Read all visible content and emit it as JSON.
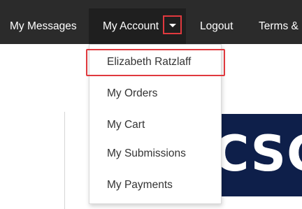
{
  "navbar": {
    "items": [
      {
        "label": "My Messages"
      },
      {
        "label": "My Account"
      },
      {
        "label": "Logout"
      },
      {
        "label": "Terms &"
      }
    ]
  },
  "account_menu": {
    "items": [
      {
        "label": "Elizabeth Ratzlaff"
      },
      {
        "label": "My Orders"
      },
      {
        "label": "My Cart"
      },
      {
        "label": "My Submissions"
      },
      {
        "label": "My Payments"
      }
    ]
  },
  "logo": {
    "text": "CSCF"
  },
  "colors": {
    "navbar_bg": "#2b2b2b",
    "highlight": "#e0393e",
    "logo_bg": "#0e1f4a"
  }
}
